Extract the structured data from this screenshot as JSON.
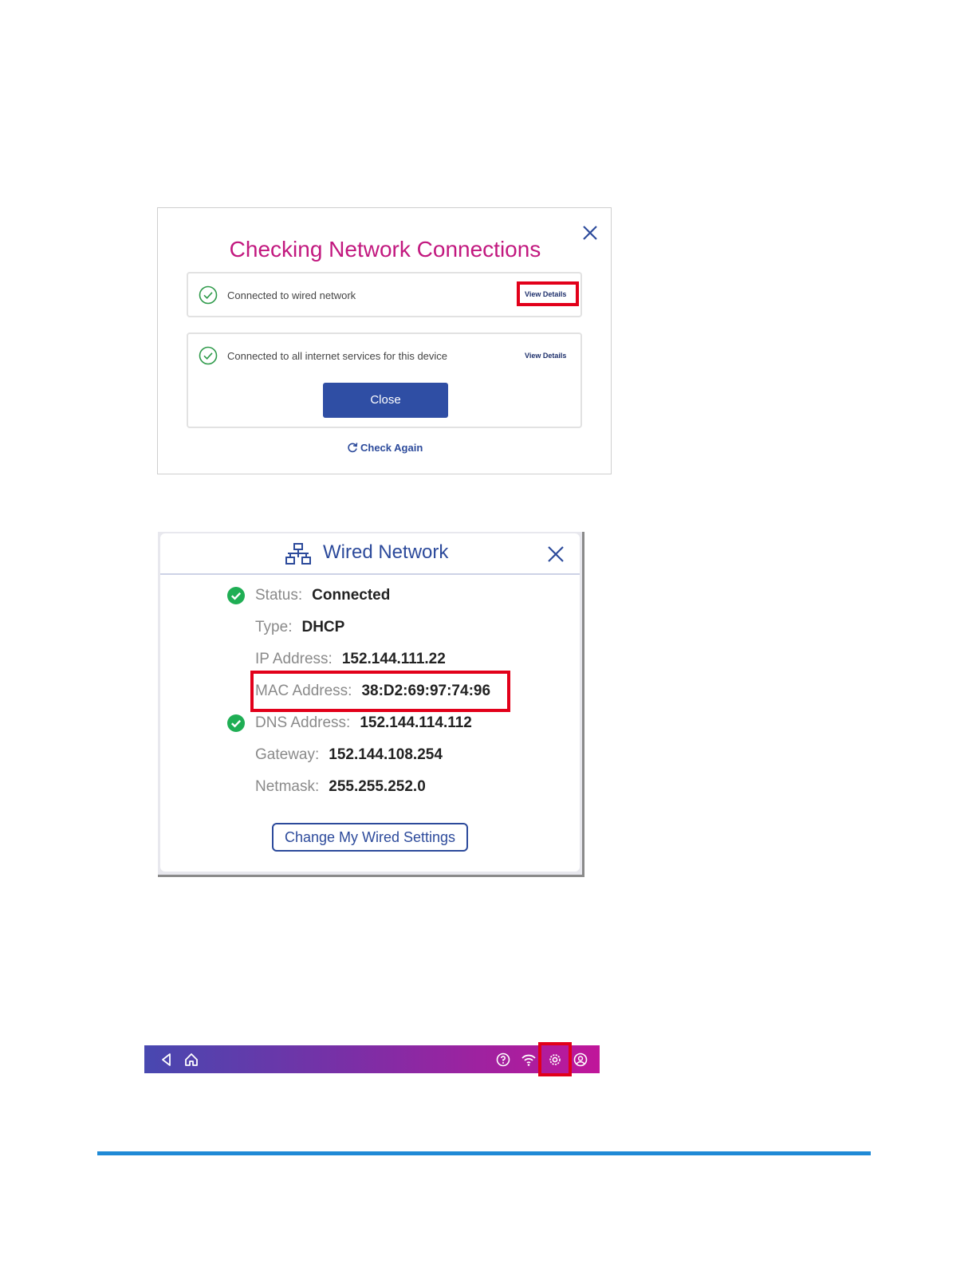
{
  "checking_dialog": {
    "title": "Checking Network Connections",
    "wired_status": "Connected to wired network",
    "internet_status": "Connected to all internet services for this device",
    "view_details_label": "View Details",
    "close_button": "Close",
    "check_again": "Check Again"
  },
  "wired_dialog": {
    "title": "Wired Network",
    "rows": [
      {
        "label": "Status:",
        "value": "Connected"
      },
      {
        "label": "Type:",
        "value": "DHCP"
      },
      {
        "label": "IP Address:",
        "value": "152.144.111.22"
      },
      {
        "label": "MAC Address:",
        "value": "38:D2:69:97:74:96"
      },
      {
        "label": "DNS Address:",
        "value": "152.144.114.112"
      },
      {
        "label": "Gateway:",
        "value": "152.144.108.254"
      },
      {
        "label": "Netmask:",
        "value": "255.255.252.0"
      }
    ],
    "change_button": "Change My Wired Settings"
  },
  "navbar": {
    "icons": [
      "back-icon",
      "home-icon",
      "help-icon",
      "wifi-icon",
      "settings-icon",
      "account-icon"
    ]
  },
  "colors": {
    "title_magenta": "#c2187f",
    "brand_blue": "#2c4a9b",
    "highlight_red": "#e2001a",
    "success_green": "#1fae54",
    "footer_rule": "#1f8ad6"
  }
}
